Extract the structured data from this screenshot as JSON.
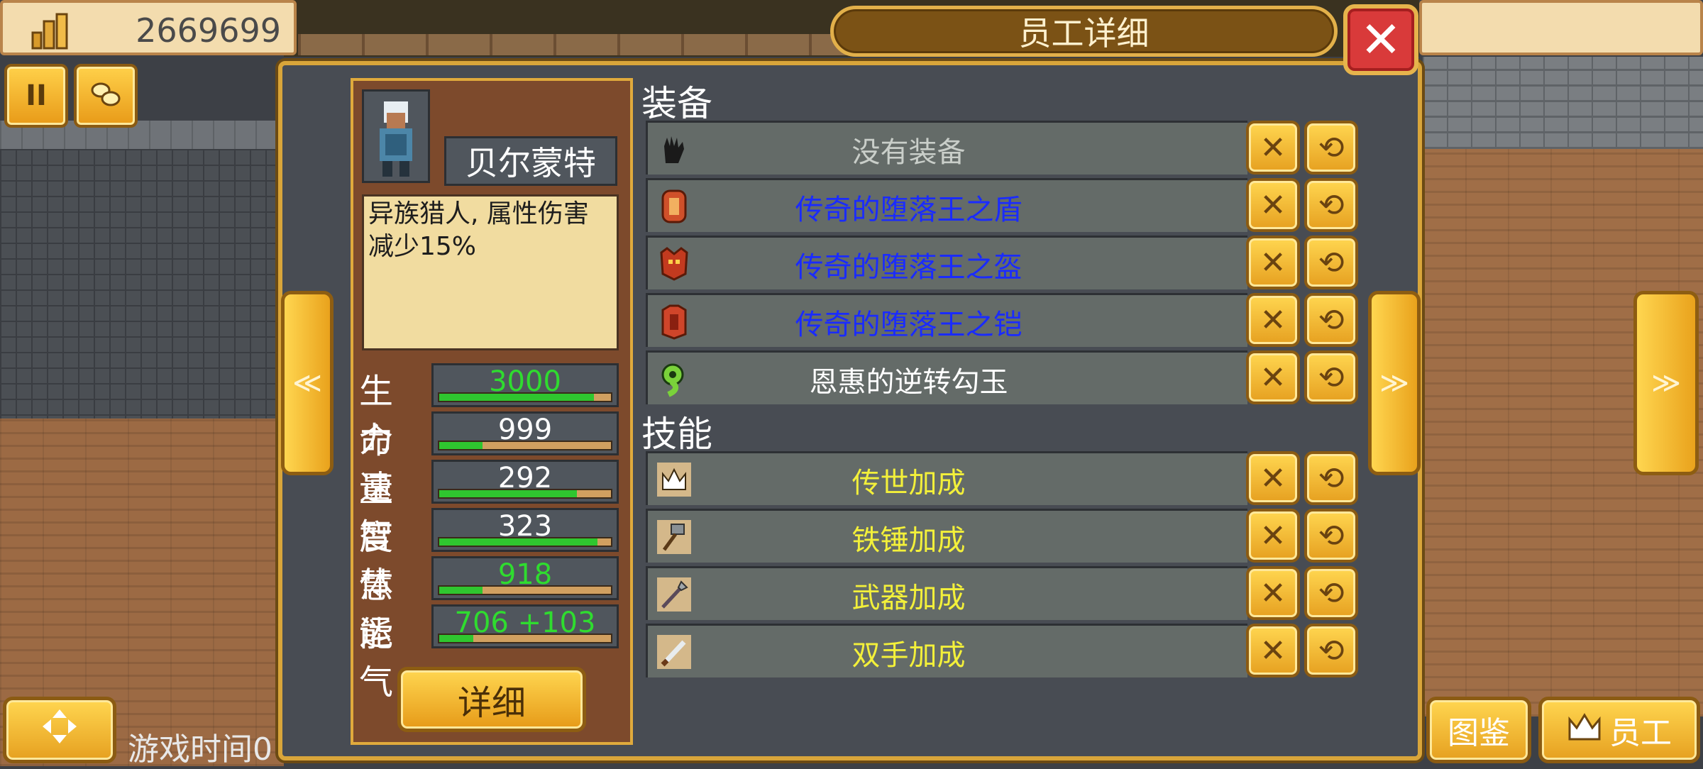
{
  "top_left": {
    "money": "2669699"
  },
  "title": "员工详细",
  "close_symbol": "✕",
  "left_buttons": {
    "pause": "II",
    "coins_icon": "coins-icon"
  },
  "nav": {
    "prev": "≪",
    "next": "≫",
    "far_next": "≫"
  },
  "character": {
    "name": "贝尔蒙特",
    "description": "异族猎人, 属性伤害减少15%",
    "stats": [
      {
        "label": "生命",
        "value": "3000",
        "fill": 0.9,
        "color": "#2fdc2f"
      },
      {
        "label": "力量",
        "value": "999",
        "fill": 0.25,
        "color": "#ffffff"
      },
      {
        "label": "速度",
        "value": "292",
        "fill": 0.8,
        "color": "#ffffff"
      },
      {
        "label": "智慧",
        "value": "323",
        "fill": 0.92,
        "color": "#ffffff"
      },
      {
        "label": "体能",
        "value": "918",
        "fill": 0.25,
        "color": "#2fdc2f"
      },
      {
        "label": "运气",
        "value": "706 +103",
        "fill": 0.2,
        "color": "#2fdc2f"
      }
    ],
    "detail_button": "详细"
  },
  "equipment": {
    "title": "装备",
    "items": [
      {
        "label": "没有装备",
        "icon": "glove-icon",
        "color": "#c9cec9"
      },
      {
        "label": "传奇的堕落王之盾",
        "icon": "shield-icon",
        "color": "#1a2bff"
      },
      {
        "label": "传奇的堕落王之盔",
        "icon": "helmet-icon",
        "color": "#1a2bff"
      },
      {
        "label": "传奇的堕落王之铠",
        "icon": "armor-icon",
        "color": "#1a2bff"
      },
      {
        "label": "恩惠的逆转勾玉",
        "icon": "magatama-icon",
        "color": "#ffffff"
      }
    ]
  },
  "skills": {
    "title": "技能",
    "items": [
      {
        "label": "传世加成",
        "icon": "crown-icon",
        "color": "#f3f03a"
      },
      {
        "label": "铁锤加成",
        "icon": "hammer-icon",
        "color": "#f3f03a"
      },
      {
        "label": "武器加成",
        "icon": "spear-icon",
        "color": "#f3f03a"
      },
      {
        "label": "双手加成",
        "icon": "sword-icon",
        "color": "#f3f03a"
      }
    ]
  },
  "row_buttons": {
    "remove": "✕",
    "swap": "⟲"
  },
  "bottom": {
    "game_time": "游戏时间0",
    "dex_button": "图鉴",
    "staff_button": "员工"
  }
}
